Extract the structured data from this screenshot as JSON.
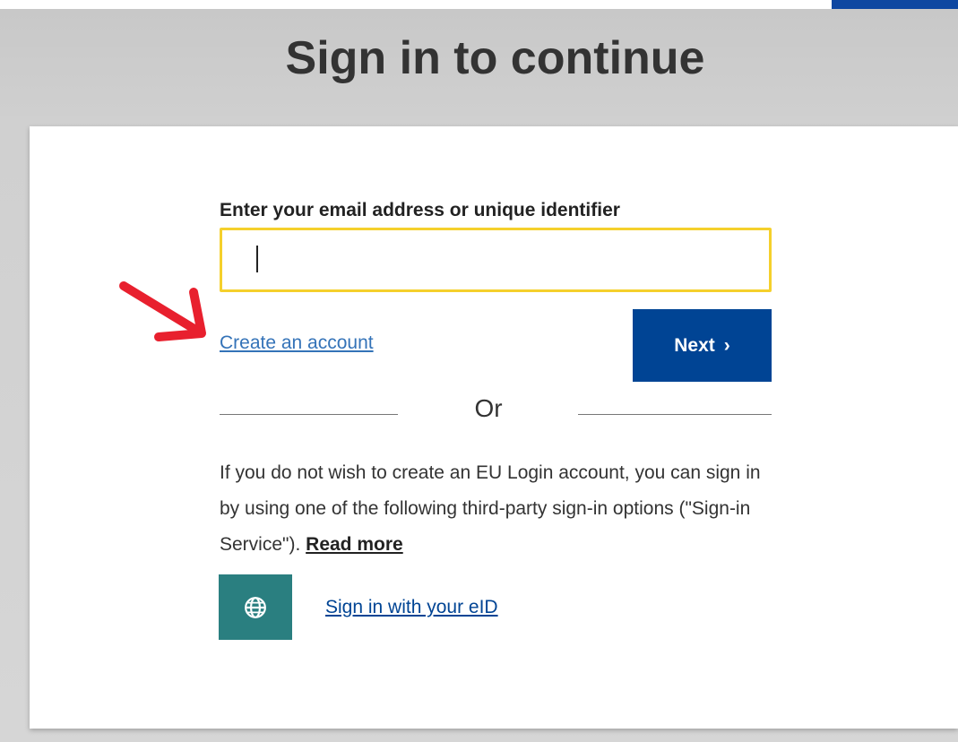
{
  "page": {
    "title": "Sign in to continue"
  },
  "form": {
    "identifier_label": "Enter your email address or unique identifier",
    "identifier_value": "",
    "create_account_link": "Create an account",
    "next_button_label": "Next",
    "next_button_chevron": "›",
    "or_label": "Or"
  },
  "third_party": {
    "info_text": "If you do not wish to create an EU Login account, you can sign in by using one of the following third-party sign-in options (\"Sign-in Service\").",
    "read_more_link": "Read more",
    "eid_icon": "globe-icon",
    "eid_link": "Sign in with your eID"
  },
  "annotation": {
    "arrow_color": "#e8202e",
    "points_to": "Create an account"
  },
  "colors": {
    "primary_blue": "#004494",
    "input_focus_border": "#f5d02c",
    "link_blue": "#3473b8",
    "eid_teal": "#2a7f80",
    "background_gray": "#d0d0d0"
  }
}
